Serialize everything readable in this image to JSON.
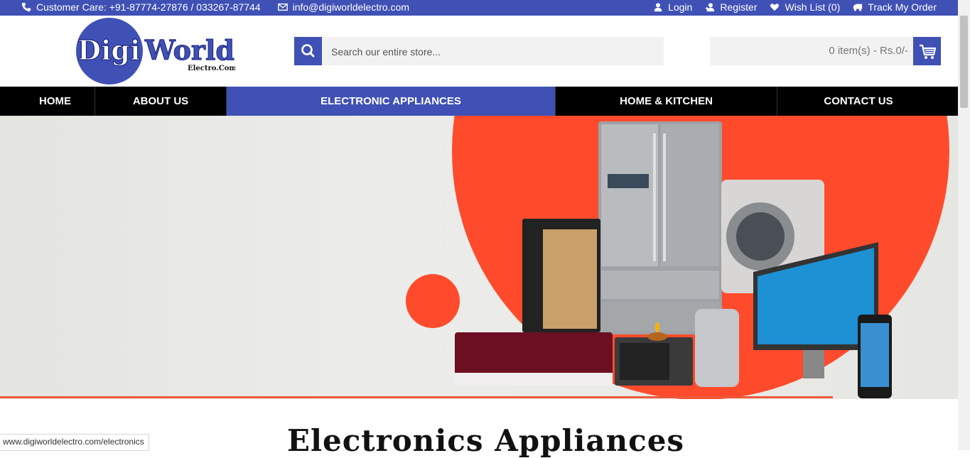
{
  "topbar": {
    "phone": "Customer Care: +91-87774-27876 / 033267-87744",
    "email": "info@digiworldelectro.com",
    "login": "Login",
    "register": "Register",
    "wishlist": "Wish List (0)",
    "track": "Track My Order"
  },
  "logo": {
    "word1": "Digi",
    "word2": "World",
    "sub": "Electro.Com"
  },
  "search": {
    "placeholder": "Search our entire store..."
  },
  "cart": {
    "summary": "0 item(s) - Rs.0/-"
  },
  "nav": {
    "items": [
      {
        "label": "HOME"
      },
      {
        "label": "ABOUT US"
      },
      {
        "label": "ELECTRONIC APPLIANCES",
        "active": true
      },
      {
        "label": "HOME & KITCHEN"
      },
      {
        "label": "CONTACT US"
      }
    ]
  },
  "section": {
    "title": "Electronics Appliances"
  },
  "status": {
    "url": "www.digiworldelectro.com/electronics"
  },
  "colors": {
    "brand": "#3f51b5",
    "accent": "#ff4b2b",
    "nav_bg": "#000000"
  }
}
